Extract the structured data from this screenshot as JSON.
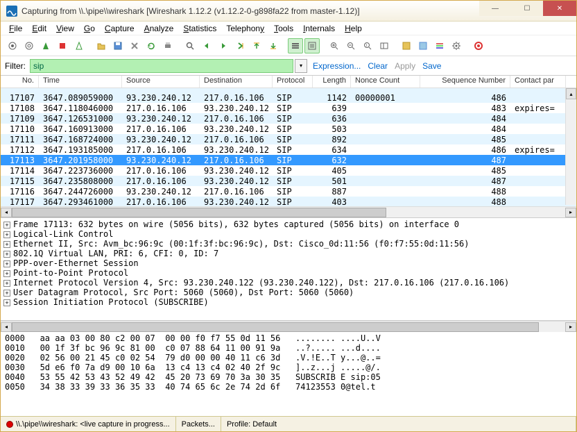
{
  "window": {
    "title": "Capturing from \\\\.\\pipe\\\\wireshark   [Wireshark 1.12.2  (v1.12.2-0-g898fa22 from master-1.12)]"
  },
  "menu": {
    "file": "File",
    "edit": "Edit",
    "view": "View",
    "go": "Go",
    "capture": "Capture",
    "analyze": "Analyze",
    "statistics": "Statistics",
    "telephony": "Telephony",
    "tools": "Tools",
    "internals": "Internals",
    "help": "Help"
  },
  "filter": {
    "label": "Filter:",
    "value": "sip",
    "expression": "Expression...",
    "clear": "Clear",
    "apply": "Apply",
    "save": "Save"
  },
  "columns": {
    "no": "No.",
    "time": "Time",
    "source": "Source",
    "destination": "Destination",
    "protocol": "Protocol",
    "length": "Length",
    "nonce": "Nonce Count",
    "seq": "Sequence Number",
    "contact": "Contact par"
  },
  "packets": [
    {
      "no": "17107",
      "time": "3647.089059000",
      "src": "93.230.240.12",
      "dst": "217.0.16.106",
      "proto": "SIP",
      "len": "1142",
      "nc": "00000001",
      "seq": "486",
      "cp": ""
    },
    {
      "no": "17108",
      "time": "3647.118046000",
      "src": "217.0.16.106",
      "dst": "93.230.240.12",
      "proto": "SIP",
      "len": "639",
      "nc": "",
      "seq": "483",
      "cp": "expires="
    },
    {
      "no": "17109",
      "time": "3647.126531000",
      "src": "93.230.240.12",
      "dst": "217.0.16.106",
      "proto": "SIP",
      "len": "636",
      "nc": "",
      "seq": "484",
      "cp": ""
    },
    {
      "no": "17110",
      "time": "3647.160913000",
      "src": "217.0.16.106",
      "dst": "93.230.240.12",
      "proto": "SIP",
      "len": "503",
      "nc": "",
      "seq": "484",
      "cp": ""
    },
    {
      "no": "17111",
      "time": "3647.168724000",
      "src": "93.230.240.12",
      "dst": "217.0.16.106",
      "proto": "SIP",
      "len": "892",
      "nc": "",
      "seq": "485",
      "cp": ""
    },
    {
      "no": "17112",
      "time": "3647.193185000",
      "src": "217.0.16.106",
      "dst": "93.230.240.12",
      "proto": "SIP",
      "len": "634",
      "nc": "",
      "seq": "486",
      "cp": "expires="
    },
    {
      "no": "17113",
      "time": "3647.201958000",
      "src": "93.230.240.12",
      "dst": "217.0.16.106",
      "proto": "SIP",
      "len": "632",
      "nc": "",
      "seq": "487",
      "cp": "",
      "sel": true
    },
    {
      "no": "17114",
      "time": "3647.223736000",
      "src": "217.0.16.106",
      "dst": "93.230.240.12",
      "proto": "SIP",
      "len": "405",
      "nc": "",
      "seq": "485",
      "cp": ""
    },
    {
      "no": "17115",
      "time": "3647.235808000",
      "src": "217.0.16.106",
      "dst": "93.230.240.12",
      "proto": "SIP",
      "len": "501",
      "nc": "",
      "seq": "487",
      "cp": ""
    },
    {
      "no": "17116",
      "time": "3647.244726000",
      "src": "93.230.240.12",
      "dst": "217.0.16.106",
      "proto": "SIP",
      "len": "887",
      "nc": "",
      "seq": "488",
      "cp": ""
    },
    {
      "no": "17117",
      "time": "3647.293461000",
      "src": "217.0.16.106",
      "dst": "93.230.240.12",
      "proto": "SIP",
      "len": "403",
      "nc": "",
      "seq": "488",
      "cp": ""
    }
  ],
  "tree": [
    "Frame 17113: 632 bytes on wire (5056 bits), 632 bytes captured (5056 bits) on interface 0",
    "Logical-Link Control",
    "Ethernet II, Src: Avm_bc:96:9c (00:1f:3f:bc:96:9c), Dst: Cisco_0d:11:56 (f0:f7:55:0d:11:56)",
    "802.1Q Virtual LAN, PRI: 6, CFI: 0, ID: 7",
    "PPP-over-Ethernet Session",
    "Point-to-Point Protocol",
    "Internet Protocol Version 4, Src: 93.230.240.122 (93.230.240.122), Dst: 217.0.16.106 (217.0.16.106)",
    "User Datagram Protocol, Src Port: 5060 (5060), Dst Port: 5060 (5060)",
    "Session Initiation Protocol (SUBSCRIBE)"
  ],
  "hex": [
    "0000   aa aa 03 00 80 c2 00 07  00 00 f0 f7 55 0d 11 56   ........ ....U..V",
    "0010   00 1f 3f bc 96 9c 81 00  c0 07 88 64 11 00 91 9a   ..?..... ...d....",
    "0020   02 56 00 21 45 c0 02 54  79 d0 00 00 40 11 c6 3d   .V.!E..T y...@..=",
    "0030   5d e6 f0 7a d9 00 10 6a  13 c4 13 c4 02 40 2f 9c   ]..z...j .....@/.",
    "0040   53 55 42 53 43 52 49 42  45 20 73 69 70 3a 30 35   SUBSCRIB E sip:05",
    "0050   34 38 33 39 33 36 35 33  40 74 65 6c 2e 74 2d 6f   74123553 0@tel.t"
  ],
  "status": {
    "pipe": "\\\\.\\pipe\\\\wireshark: <live capture in progress...",
    "packets": "Packets...",
    "profile": "Profile: Default"
  }
}
